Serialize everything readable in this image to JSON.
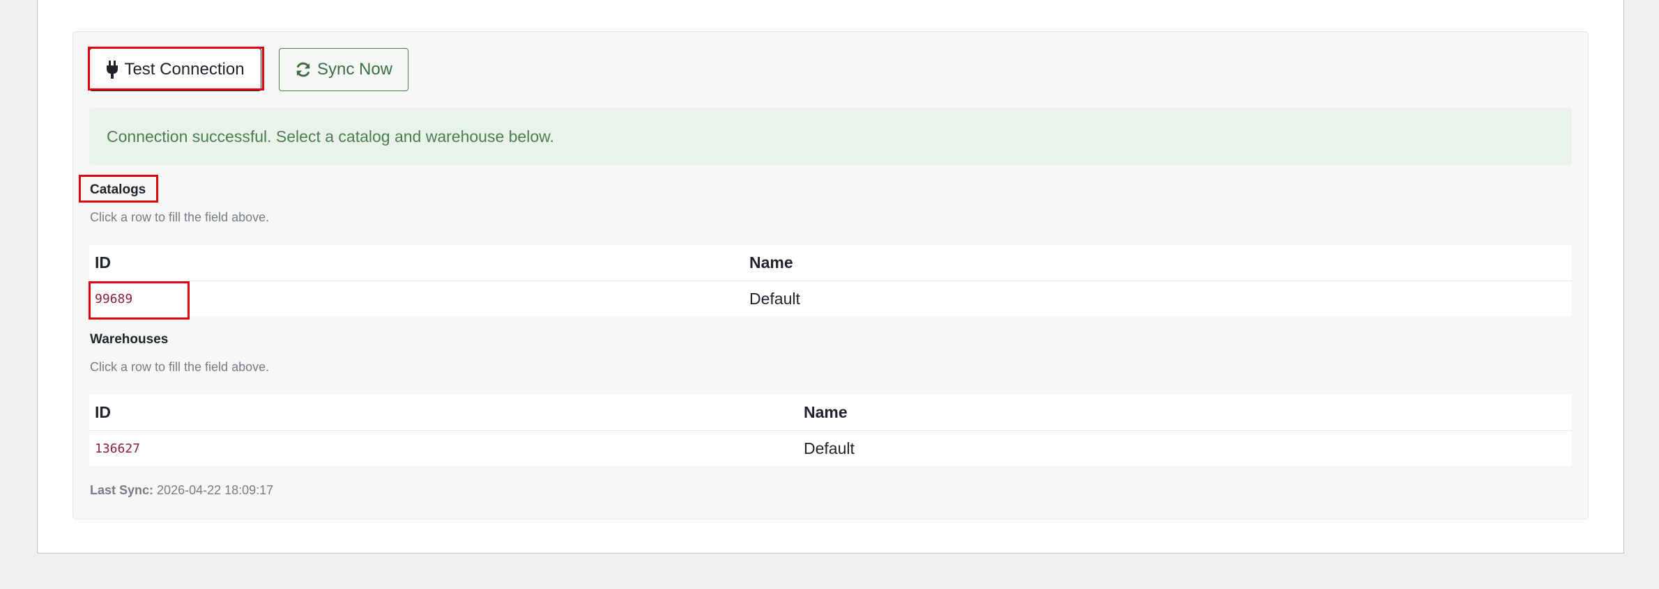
{
  "toolbar": {
    "test_connection_label": "Test Connection",
    "sync_now_label": "Sync Now"
  },
  "notice": {
    "message": "Connection successful. Select a catalog and warehouse below."
  },
  "catalogs": {
    "title": "Catalogs",
    "hint": "Click a row to fill the field above.",
    "columns": [
      "ID",
      "Name"
    ],
    "rows": [
      {
        "id": "99689",
        "name": "Default"
      }
    ]
  },
  "warehouses": {
    "title": "Warehouses",
    "hint": "Click a row to fill the field above.",
    "columns": [
      "ID",
      "Name"
    ],
    "rows": [
      {
        "id": "136627",
        "name": "Default"
      }
    ]
  },
  "last_sync": {
    "label": "Last Sync:",
    "value": "2026-04-22 18:09:17"
  },
  "colors": {
    "success_bg": "#eaf3ea",
    "success_text": "#4a7d4e",
    "highlight": "#e0000f",
    "id_text": "#8a1f3a"
  },
  "icons": {
    "test_connection": "plug-icon",
    "sync_now": "refresh-icon"
  }
}
